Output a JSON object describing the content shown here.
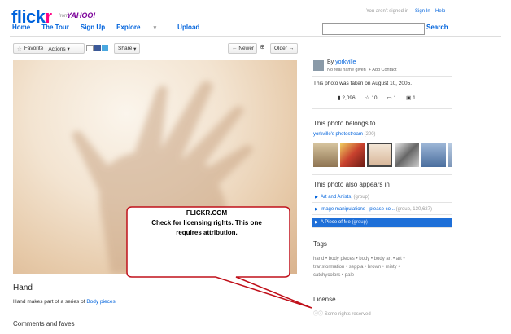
{
  "header": {
    "logo_main": "flickr",
    "logo_from": "from",
    "logo_yahoo": "YAHOO!",
    "nav": [
      "Home",
      "The Tour",
      "Sign Up",
      "Explore",
      "Upload"
    ],
    "explore_arrow": "▾",
    "not_signed_in": "You aren't signed in",
    "sign_in": "Sign In",
    "help": "Help",
    "search_value": "",
    "search_button": "Search"
  },
  "toolbar": {
    "favorite": "Favorite",
    "actions": "Actions",
    "share": "Share",
    "newer": "Newer",
    "older": "Older"
  },
  "photo": {
    "title": "Hand",
    "description_prefix": "Hand makes part of a series of",
    "description_link": "Body pieces",
    "comments_heading": "Comments and faves"
  },
  "callout": {
    "line1": "FLICKR.COM",
    "line2": "Check for licensing rights. This one",
    "line3": "requires attribution."
  },
  "owner": {
    "by": "By",
    "name": "yorkville",
    "real_name": "No real name given",
    "add_contact": "+ Add Contact"
  },
  "photo_info": {
    "taken": "This photo was taken on August 10, 2005.",
    "views": "2,096",
    "faves": "10",
    "comments": "1",
    "notes": "1"
  },
  "belongs": {
    "heading": "This photo belongs to",
    "stream": "yorkville's photostream",
    "count": "(200)",
    "thumb_colors": [
      "#b9a078",
      "#c8412e",
      "#e6d2c0",
      "#8a8f8c",
      "#5c7aa5",
      "#8fa8c9"
    ]
  },
  "appears": {
    "heading": "This photo also appears in",
    "items": [
      {
        "name": "Art and Artists,",
        "meta": "(group)"
      },
      {
        "name": "image manipulations - please co...",
        "meta": "(group, 130,627)"
      },
      {
        "name": "A Piece of Me",
        "meta": "(group)"
      }
    ]
  },
  "tags": {
    "heading": "Tags",
    "line1": "hand • body pieces • body • body art • art •",
    "line2": "transformation • seppia • brown • misty •",
    "line3": "catchycolors • pale"
  },
  "license": {
    "heading": "License",
    "text": "Some rights reserved"
  },
  "colors": {
    "accent": "#0063dc",
    "pink": "#ff0084",
    "highlight": "#1e6fd8",
    "callout_border": "#c0101a"
  }
}
